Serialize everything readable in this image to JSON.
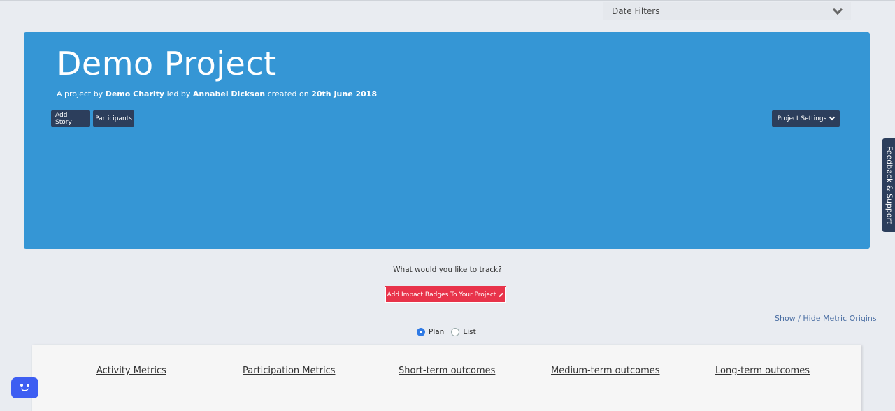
{
  "date_filters": {
    "label": "Date Filters"
  },
  "hero": {
    "title": "Demo Project",
    "sub_prefix": "A project by",
    "org": "Demo Charity",
    "led_by": "led by",
    "leader": "Annabel Dickson",
    "created_on": "created on",
    "date": "20th June 2018",
    "add_story": "Add Story",
    "participants": "Participants",
    "project_settings": "Project Settings"
  },
  "feedback": {
    "label": "Feedback & Support"
  },
  "track": {
    "question": "What would you like to track?",
    "add_badges": "Add Impact Badges To Your Project"
  },
  "metric_origins": "Show / Hide Metric Origins",
  "view_toggle": {
    "plan": "Plan",
    "list": "List",
    "selected": "Plan"
  },
  "metric_tabs": [
    "Activity Metrics",
    "Participation Metrics",
    "Short-term outcomes",
    "Medium-term outcomes",
    "Long-term outcomes"
  ],
  "colors": {
    "hero": "#3596d5",
    "dark_button": "#2c3e5c",
    "red_button": "#e8334a",
    "chat": "#3d5ef2"
  }
}
